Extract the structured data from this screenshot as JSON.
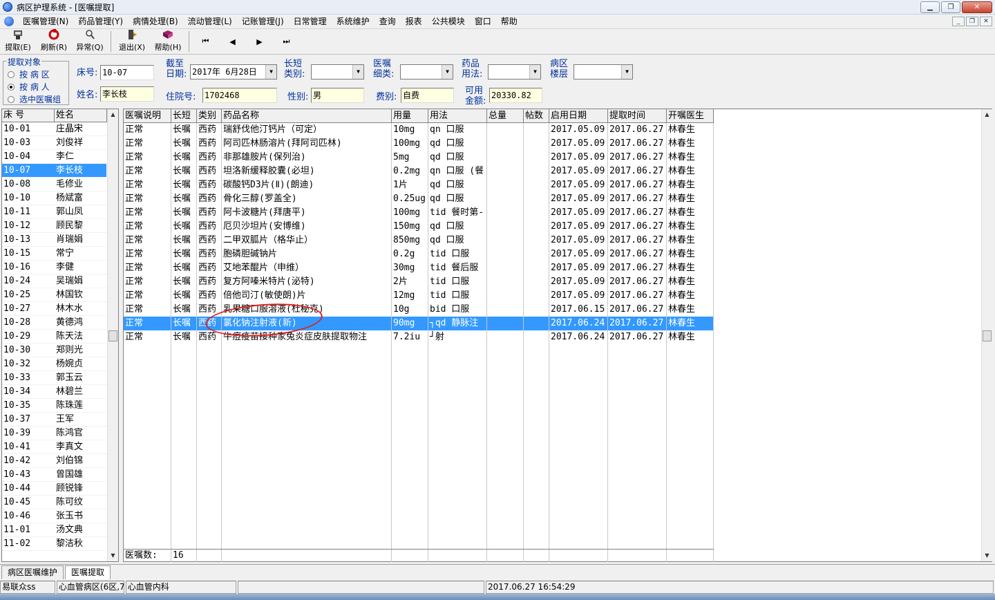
{
  "window": {
    "title": "病区护理系统 - [医嘱提取]"
  },
  "menu": [
    "医嘱管理(N)",
    "药品管理(Y)",
    "病情处理(B)",
    "流动管理(L)",
    "记账管理(J)",
    "日常管理",
    "系统维护",
    "查询",
    "报表",
    "公共模块",
    "窗口",
    "帮助"
  ],
  "toolbar": {
    "buttons": [
      {
        "label": "提取(E)",
        "icon": "extract-icon"
      },
      {
        "label": "刷新(R)",
        "icon": "refresh-icon"
      },
      {
        "label": "异常(Q)",
        "icon": "exception-icon"
      },
      {
        "label": "退出(X)",
        "icon": "exit-icon"
      },
      {
        "label": "帮助(H)",
        "icon": "help-book-icon"
      }
    ],
    "nav": [
      "⏮",
      "◀",
      "▶",
      "⏭"
    ]
  },
  "params": {
    "group_title": "提取对象",
    "radios": [
      {
        "label": "按 病 区",
        "checked": false
      },
      {
        "label": "按 病 人",
        "checked": true
      },
      {
        "label": "选中医嘱组",
        "checked": false
      }
    ],
    "bed_label": "床号:",
    "bed_value": "10-07",
    "date_label1": "截至",
    "date_label2": "日期:",
    "date_value": "2017年 6月28日",
    "longshort_label1": "长短",
    "longshort_label2": "类别:",
    "longshort_value": "",
    "order_label1": "医嘱",
    "order_label2": "细类:",
    "order_value": "",
    "usage_label1": "药品",
    "usage_label2": "用法:",
    "usage_value": "",
    "floor_label1": "病区",
    "floor_label2": "楼层",
    "floor_value": "",
    "name_label": "姓名:",
    "name_value": "李长枝",
    "hosp_label": "住院号:",
    "hosp_value": "1702468",
    "sex_label": "性别:",
    "sex_value": "男",
    "fee_label": "费别:",
    "fee_value": "自费",
    "avail_label1": "可用",
    "avail_label2": "金额:",
    "avail_value": "20330.82"
  },
  "patients": {
    "headers": [
      "床 号",
      "姓名"
    ],
    "rows": [
      [
        "10-01",
        "庄晶宋"
      ],
      [
        "10-03",
        "刘俊祥"
      ],
      [
        "10-04",
        "李仁"
      ],
      [
        "10-07",
        "李长枝"
      ],
      [
        "10-08",
        "毛修业"
      ],
      [
        "10-10",
        "杨斌富"
      ],
      [
        "10-11",
        "郭山凤"
      ],
      [
        "10-12",
        "顾民黎"
      ],
      [
        "10-13",
        "肖瑞娟"
      ],
      [
        "10-15",
        "常宁"
      ],
      [
        "10-16",
        "李健"
      ],
      [
        "10-24",
        "吴瑞娟"
      ],
      [
        "10-25",
        "林国钦"
      ],
      [
        "10-27",
        "林木水"
      ],
      [
        "10-28",
        "黄德鸿"
      ],
      [
        "10-29",
        "陈天法"
      ],
      [
        "10-30",
        "郑则光"
      ],
      [
        "10-32",
        "杨婉贞"
      ],
      [
        "10-33",
        "郭玉云"
      ],
      [
        "10-34",
        "林碧兰"
      ],
      [
        "10-35",
        "陈珠莲"
      ],
      [
        "10-37",
        "王军"
      ],
      [
        "10-39",
        "陈鸿官"
      ],
      [
        "10-41",
        "李真文"
      ],
      [
        "10-42",
        "刘伯锦"
      ],
      [
        "10-43",
        "曾国雄"
      ],
      [
        "10-44",
        "顾锐锋"
      ],
      [
        "10-45",
        "陈可纹"
      ],
      [
        "10-46",
        "张玉书"
      ],
      [
        "11-01",
        "汤文典"
      ],
      [
        "11-02",
        "黎洁秋"
      ]
    ],
    "selected": 3
  },
  "orders": {
    "headers": [
      "医嘱说明",
      "长短",
      "类别",
      "药品名称",
      "用量",
      "用法",
      "总量",
      "帖数",
      "启用日期",
      "提取时间",
      "开嘱医生"
    ],
    "rows": [
      [
        "正常",
        "长嘱",
        "西药",
        "瑞舒伐他汀钙片（可定）",
        "10mg",
        "qn 口服",
        "",
        "",
        "2017.05.09",
        "2017.06.27",
        "林春生"
      ],
      [
        "正常",
        "长嘱",
        "西药",
        "阿司匹林肠溶片(拜阿司匹林)",
        "100mg",
        "qd 口服",
        "",
        "",
        "2017.05.09",
        "2017.06.27",
        "林春生"
      ],
      [
        "正常",
        "长嘱",
        "西药",
        "非那雄胺片(保列治)",
        "5mg",
        "qd 口服",
        "",
        "",
        "2017.05.09",
        "2017.06.27",
        "林春生"
      ],
      [
        "正常",
        "长嘱",
        "西药",
        "坦洛新缓释胶囊(必坦)",
        "0.2mg",
        "qn 口服 (餐",
        "",
        "",
        "2017.05.09",
        "2017.06.27",
        "林春生"
      ],
      [
        "正常",
        "长嘱",
        "西药",
        "碳酸钙D3片(Ⅱ)(朗迪)",
        "1片",
        "qd 口服",
        "",
        "",
        "2017.05.09",
        "2017.06.27",
        "林春生"
      ],
      [
        "正常",
        "长嘱",
        "西药",
        "骨化三醇(罗盖全)",
        "0.25ug",
        "qd 口服",
        "",
        "",
        "2017.05.09",
        "2017.06.27",
        "林春生"
      ],
      [
        "正常",
        "长嘱",
        "西药",
        "阿卡波糖片(拜唐平)",
        "100mg",
        "tid 餐时第-",
        "",
        "",
        "2017.05.09",
        "2017.06.27",
        "林春生"
      ],
      [
        "正常",
        "长嘱",
        "西药",
        "厄贝沙坦片(安博维)",
        "150mg",
        "qd 口服",
        "",
        "",
        "2017.05.09",
        "2017.06.27",
        "林春生"
      ],
      [
        "正常",
        "长嘱",
        "西药",
        "二甲双胍片（格华止）",
        "850mg",
        "qd 口服",
        "",
        "",
        "2017.05.09",
        "2017.06.27",
        "林春生"
      ],
      [
        "正常",
        "长嘱",
        "西药",
        "胞磷胆碱钠片",
        "0.2g",
        "tid 口服",
        "",
        "",
        "2017.05.09",
        "2017.06.27",
        "林春生"
      ],
      [
        "正常",
        "长嘱",
        "西药",
        "艾地苯醌片（申维）",
        "30mg",
        "tid 餐后服",
        "",
        "",
        "2017.05.09",
        "2017.06.27",
        "林春生"
      ],
      [
        "正常",
        "长嘱",
        "西药",
        "复方阿嗪米特片(泌特)",
        "2片",
        "tid 口服",
        "",
        "",
        "2017.05.09",
        "2017.06.27",
        "林春生"
      ],
      [
        "正常",
        "长嘱",
        "西药",
        "倍他司汀(敏使朗)片",
        "12mg",
        "tid 口服",
        "",
        "",
        "2017.05.09",
        "2017.06.27",
        "林春生"
      ],
      [
        "正常",
        "长嘱",
        "西药",
        "乳果糖口服溶液(杜秘克)",
        "10g",
        "bid 口服",
        "",
        "",
        "2017.06.15",
        "2017.06.27",
        "林春生"
      ],
      [
        "正常",
        "长嘱",
        "西药",
        "氯化钠注射液(新)",
        "90mg",
        "┐qd 静脉注",
        "",
        "",
        "2017.06.24",
        "2017.06.27",
        "林春生"
      ],
      [
        "正常",
        "长嘱",
        "西药",
        "牛痘疫苗接种家兔炎症皮肤提取物注",
        "7.2iu",
        "┘射",
        "",
        "",
        "2017.06.24",
        "2017.06.27",
        "林春生"
      ]
    ],
    "selected": 14,
    "footer_label": "医嘱数:",
    "footer_count": "16"
  },
  "tabs": [
    "病区医嘱维护",
    "医嘱提取"
  ],
  "status": [
    "易联众ss",
    "心血管病区(6区,7",
    "心血管内科",
    "",
    "2017.06.27 16:54:29"
  ]
}
